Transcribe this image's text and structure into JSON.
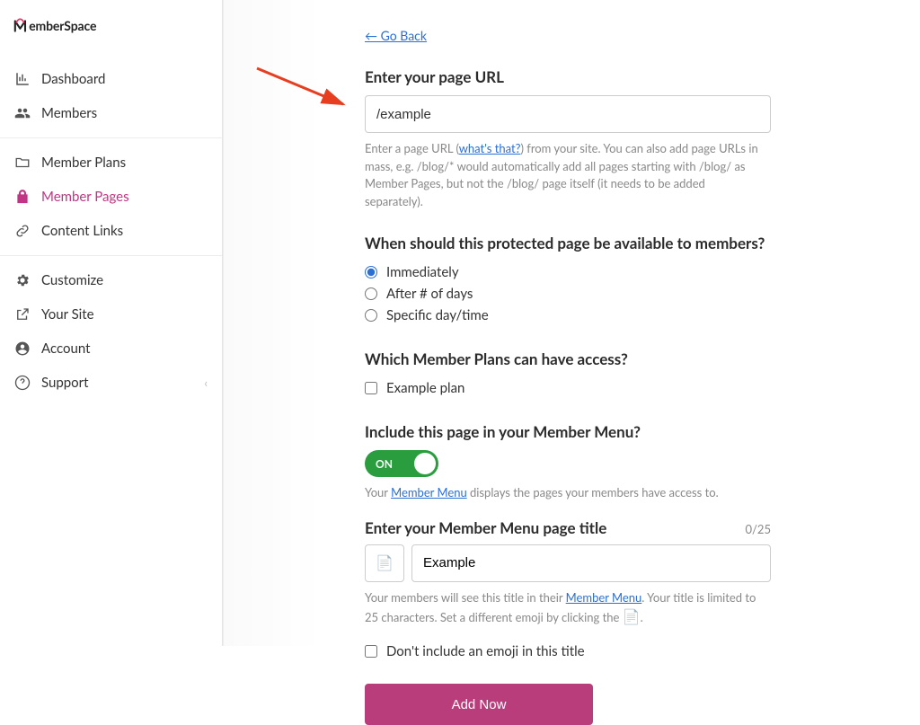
{
  "brand": "MemberSpace",
  "sidebar": {
    "items": [
      {
        "label": "Dashboard"
      },
      {
        "label": "Members"
      },
      {
        "label": "Member Plans"
      },
      {
        "label": "Member Pages"
      },
      {
        "label": "Content Links"
      },
      {
        "label": "Customize"
      },
      {
        "label": "Your Site"
      },
      {
        "label": "Account"
      },
      {
        "label": "Support"
      }
    ]
  },
  "go_back": "← Go Back",
  "url": {
    "title": "Enter your page URL",
    "value": "/example",
    "help_a": "Enter a page URL (",
    "help_link": "what's that?",
    "help_b": ") from your site. You can also add page URLs in mass, e.g. /blog/* would automatically add all pages starting with /blog/ as Member Pages, but not the /blog/ page itself (it needs to be added separately)."
  },
  "availability": {
    "title": "When should this protected page be available to members?",
    "options": [
      {
        "label": "Immediately"
      },
      {
        "label": "After # of days"
      },
      {
        "label": "Specific day/time"
      }
    ]
  },
  "plans": {
    "title": "Which Member Plans can have access?",
    "options": [
      {
        "label": "Example plan"
      }
    ]
  },
  "menu": {
    "title": "Include this page in your Member Menu?",
    "toggle_label": "ON",
    "help_a": "Your ",
    "help_link": "Member Menu",
    "help_b": " displays the pages your members have access to."
  },
  "page_title": {
    "title": "Enter your Member Menu page title",
    "char_count": "0/25",
    "value": "Example",
    "help_a": "Your members will see this title in their ",
    "help_link": "Member Menu",
    "help_b": ". Your title is limited to 25 characters. Set a different emoji by clicking the ",
    "help_c": ".",
    "emoji_checkbox": "Don't include an emoji in this title"
  },
  "submit": "Add Now"
}
